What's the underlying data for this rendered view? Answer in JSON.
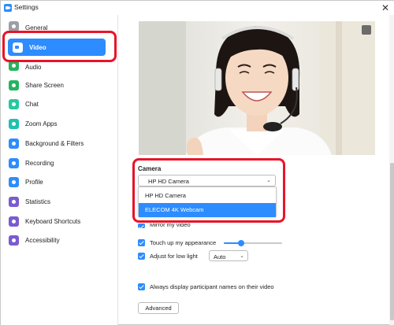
{
  "window": {
    "title": "Settings",
    "close_glyph": "✕"
  },
  "sidebar": {
    "items": [
      {
        "label": "General",
        "icon": "gear-icon",
        "color": "#9aa0a6"
      },
      {
        "label": "Video",
        "icon": "video-camera-icon",
        "color": "#2d8cff",
        "active": true
      },
      {
        "label": "Audio",
        "icon": "headphones-icon",
        "color": "#25b35f"
      },
      {
        "label": "Share Screen",
        "icon": "share-screen-icon",
        "color": "#25b35f"
      },
      {
        "label": "Chat",
        "icon": "chat-bubble-icon",
        "color": "#25c9a0"
      },
      {
        "label": "Zoom Apps",
        "icon": "apps-icon",
        "color": "#1fc1b0"
      },
      {
        "label": "Background & Filters",
        "icon": "background-filters-icon",
        "color": "#2d8cff"
      },
      {
        "label": "Recording",
        "icon": "recording-icon",
        "color": "#2d8cff"
      },
      {
        "label": "Profile",
        "icon": "profile-icon",
        "color": "#2d8cff"
      },
      {
        "label": "Statistics",
        "icon": "statistics-icon",
        "color": "#7a5bd0"
      },
      {
        "label": "Keyboard Shortcuts",
        "icon": "keyboard-icon",
        "color": "#7a5bd0"
      },
      {
        "label": "Accessibility",
        "icon": "accessibility-icon",
        "color": "#7a5bd0"
      }
    ]
  },
  "camera": {
    "label": "Camera",
    "selected": "HP HD Camera",
    "arrow": "⌄",
    "options": [
      "HP HD Camera",
      "ELECOM 4K Webcam"
    ],
    "highlighted_option": "ELECOM 4K Webcam"
  },
  "options": {
    "mirror_video_partial": "Mirror my video",
    "touch_up": "Touch up my appearance",
    "touch_up_level": 0.3,
    "low_light": "Adjust for low light",
    "low_light_value": "Auto",
    "low_light_arrow": "⌄",
    "display_names": "Always display participant names on their video"
  },
  "advanced_button": "Advanced",
  "colors": {
    "accent": "#2d8cff",
    "highlight_ring": "#e8142a"
  }
}
